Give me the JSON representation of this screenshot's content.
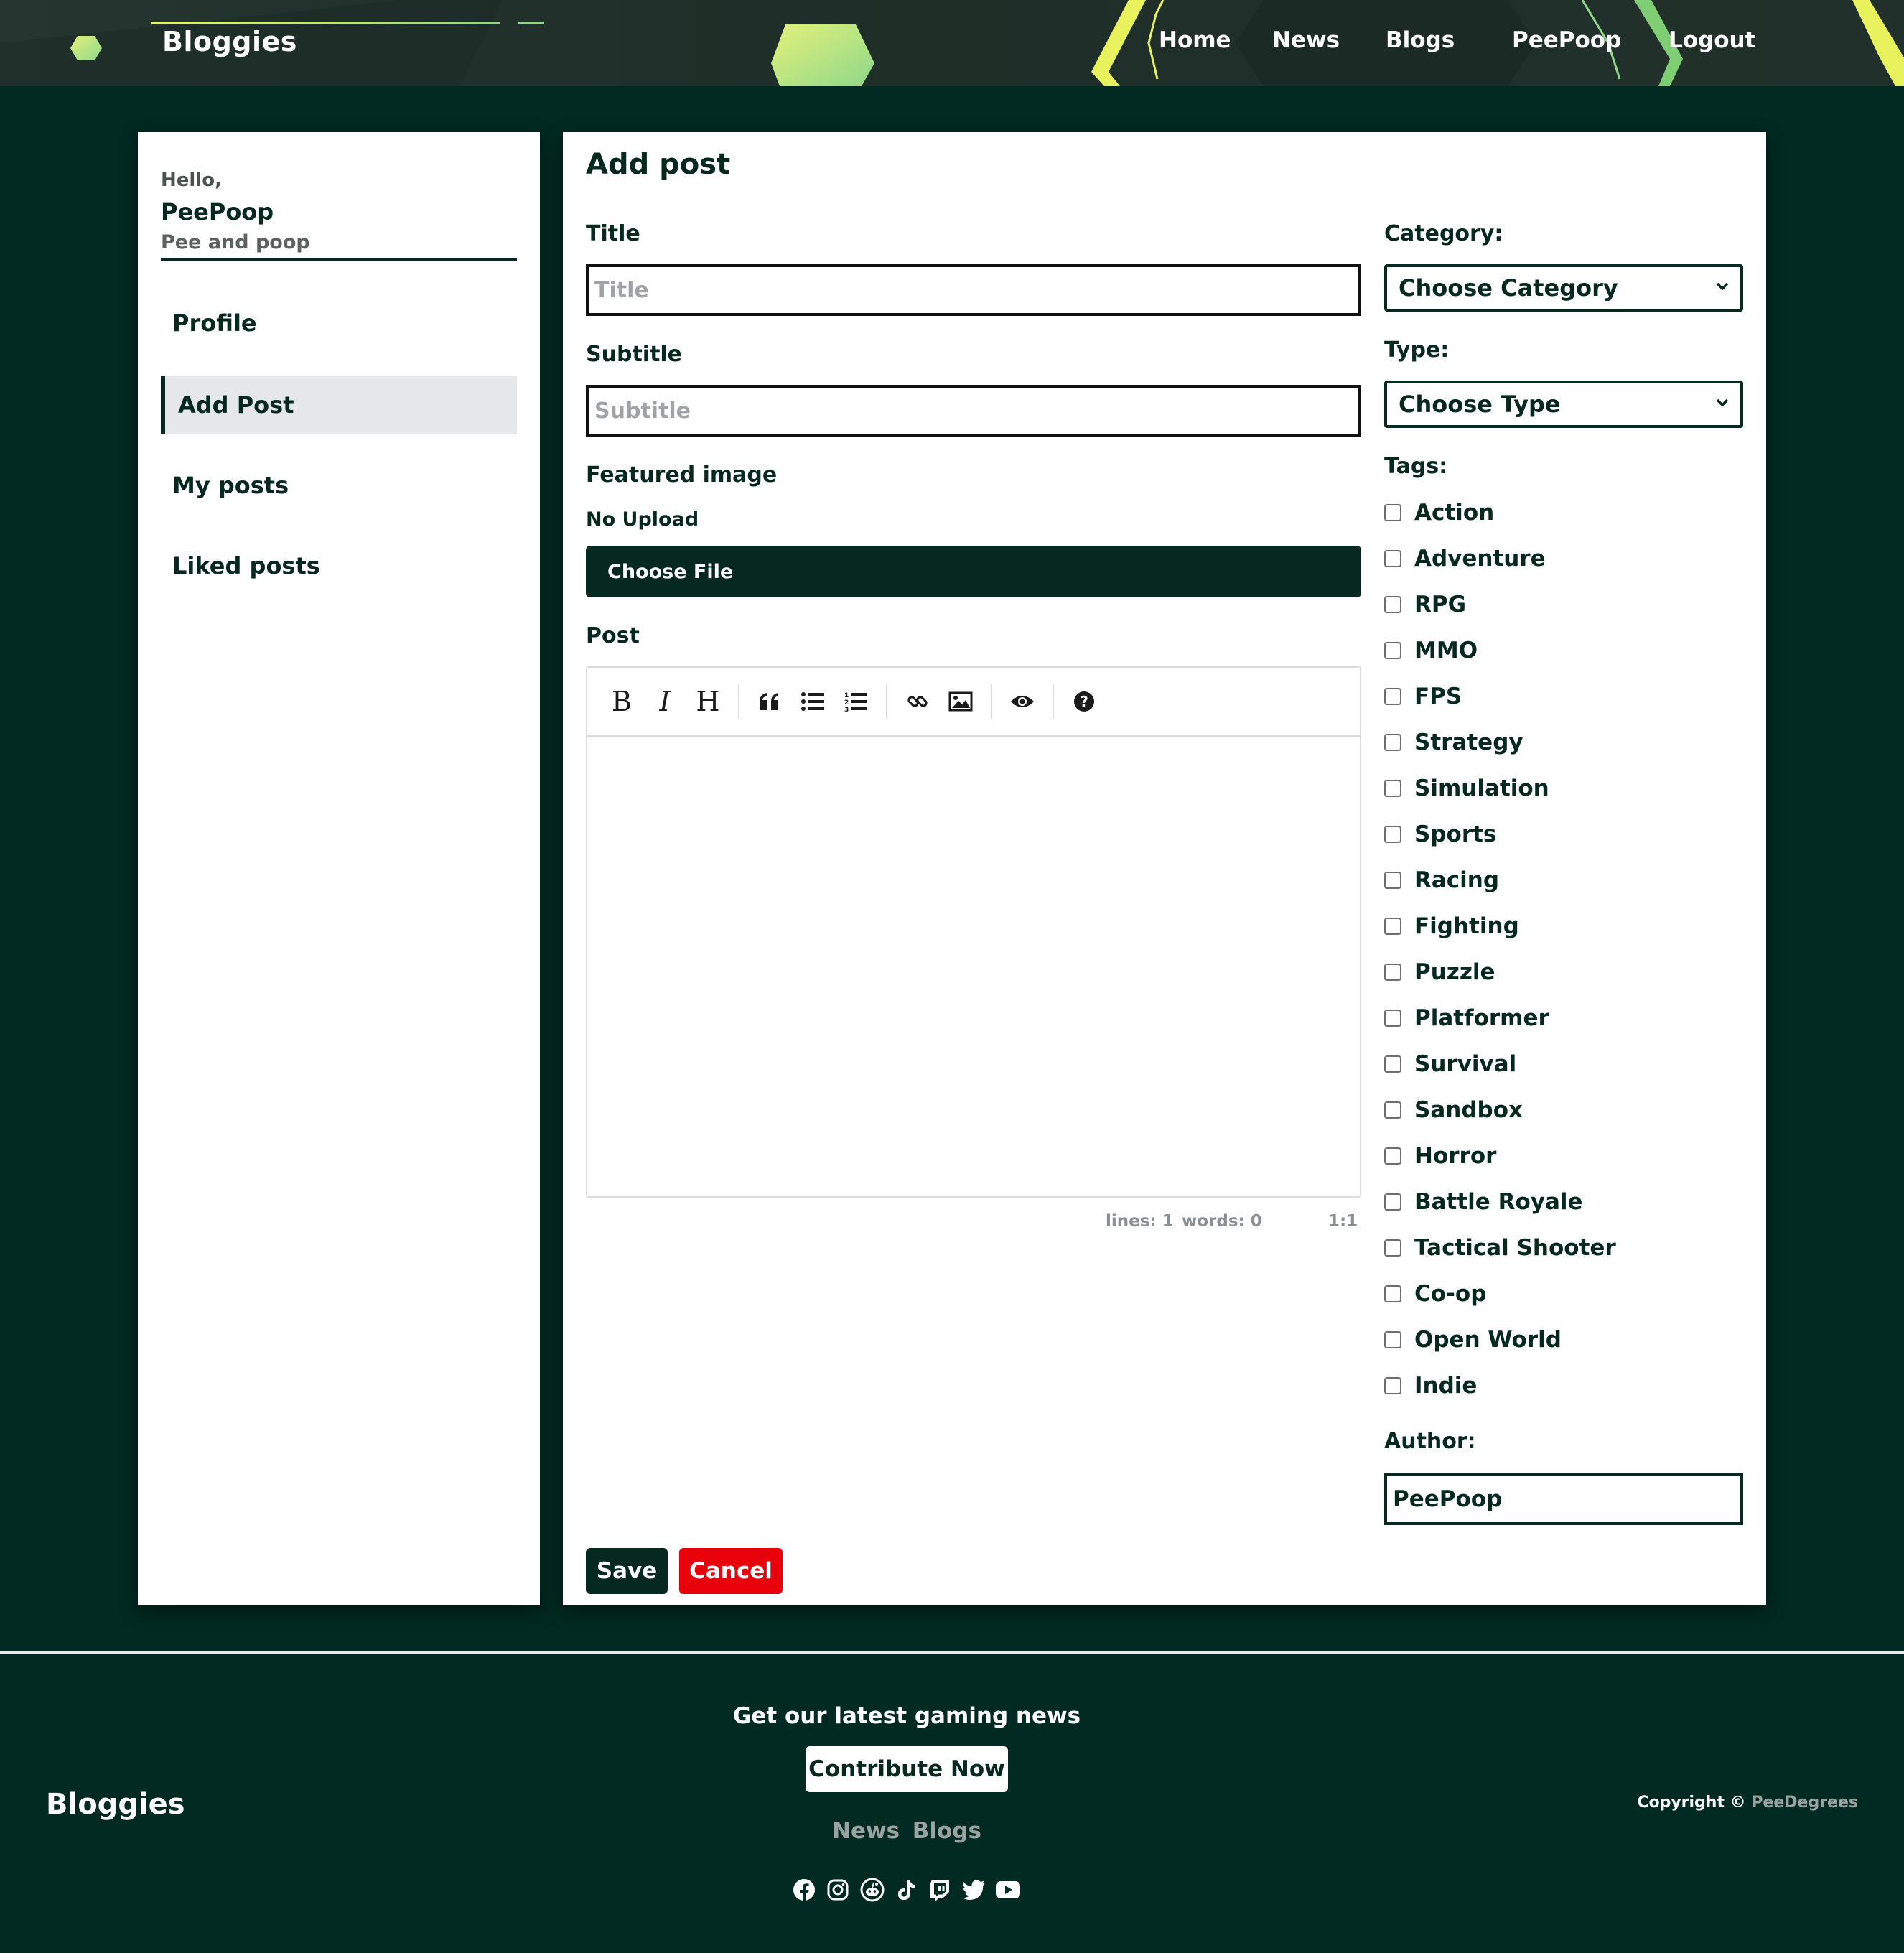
{
  "nav": {
    "brand": "Bloggies",
    "links": [
      "Home",
      "News",
      "Blogs",
      "PeePoop",
      "Logout"
    ]
  },
  "sidebar": {
    "greeting": "Hello,",
    "username": "PeePoop",
    "bio": "Pee and poop",
    "items": [
      "Profile",
      "Add Post",
      "My posts",
      "Liked posts"
    ],
    "active": "Add Post"
  },
  "form": {
    "heading": "Add post",
    "title_label": "Title",
    "title_placeholder": "Title",
    "subtitle_label": "Subtitle",
    "subtitle_placeholder": "Subtitle",
    "featured_label": "Featured image",
    "upload_status": "No Upload",
    "choose_file": "Choose File",
    "post_label": "Post",
    "editor_status": {
      "lines": "lines: 1",
      "words": "words: 0",
      "cursor": "1:1"
    },
    "category_label": "Category:",
    "category_value": "Choose Category",
    "type_label": "Type:",
    "type_value": "Choose Type",
    "tags_label": "Tags:",
    "tags": [
      "Action",
      "Adventure",
      "RPG",
      "MMO",
      "FPS",
      "Strategy",
      "Simulation",
      "Sports",
      "Racing",
      "Fighting",
      "Puzzle",
      "Platformer",
      "Survival",
      "Sandbox",
      "Horror",
      "Battle Royale",
      "Tactical Shooter",
      "Co-op",
      "Open World",
      "Indie"
    ],
    "author_label": "Author:",
    "author_value": "PeePoop",
    "save": "Save",
    "cancel": "Cancel"
  },
  "footer": {
    "brand": "Bloggies",
    "cta": "Get our latest gaming news",
    "contribute": "Contribute Now",
    "links": [
      "News",
      "Blogs"
    ],
    "copyright_prefix": "Copyright ©",
    "copyright_owner": "PeeDegrees",
    "socials": [
      "facebook-icon",
      "instagram-icon",
      "reddit-icon",
      "tiktok-icon",
      "twitch-icon",
      "twitter-icon",
      "youtube-icon"
    ]
  },
  "colors": {
    "page_bg": "#002a22",
    "navbar_bg": "#22302b",
    "brand_dark": "#06291f",
    "accent_yellow": "#e8f25c",
    "accent_green": "#8fd88a",
    "cancel_red": "#e8000b"
  }
}
